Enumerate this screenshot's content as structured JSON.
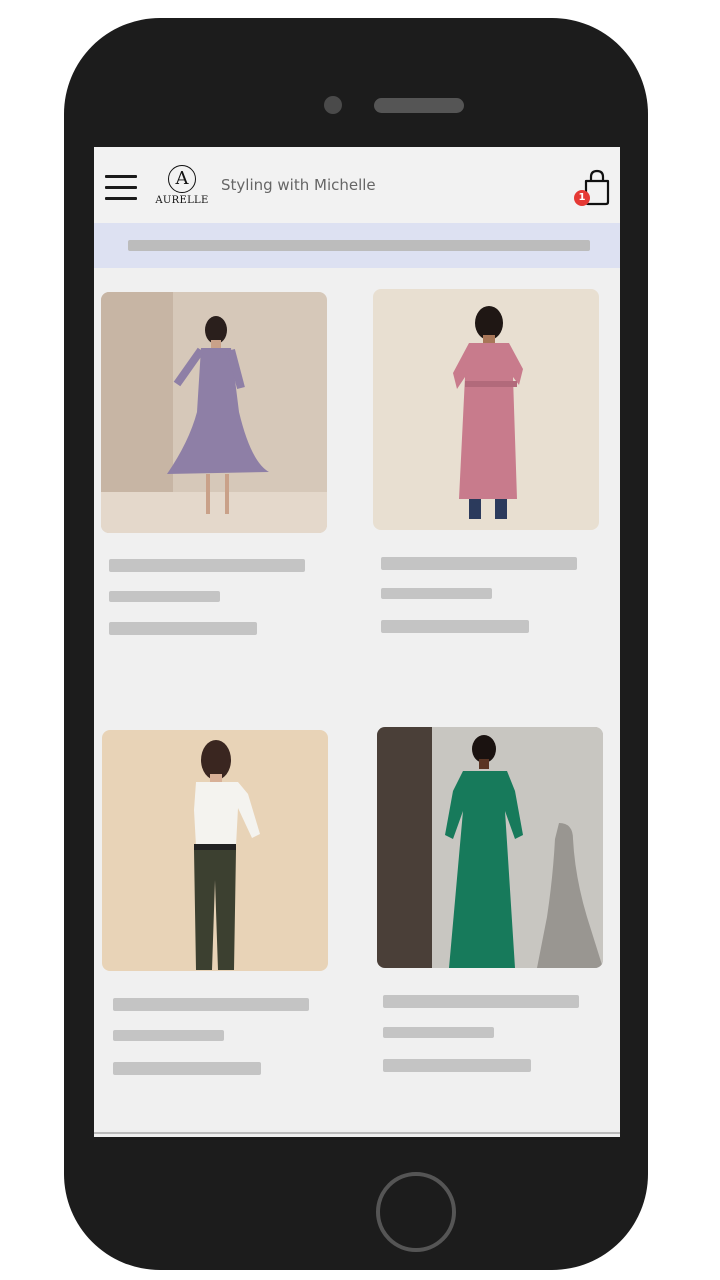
{
  "header": {
    "logo_mark": "A",
    "logo_word": "AURELLE",
    "title": "Styling with Michelle",
    "cart_count": "1"
  },
  "products": [
    {
      "image_icon": "lavender-wrap-dress-photo",
      "dress_color": "#8e7fa6",
      "bg_color": "#d9ccbe"
    },
    {
      "image_icon": "pink-belted-tunic-photo",
      "dress_color": "#c87b8c",
      "bg_color": "#e9e1d4"
    },
    {
      "image_icon": "white-shirt-olive-pants-photo",
      "dress_color": "#f4f3ef",
      "bg_color": "#e9d4b8"
    },
    {
      "image_icon": "green-wrap-dress-photo",
      "dress_color": "#177a5b",
      "bg_color": "#bdbab4"
    }
  ]
}
